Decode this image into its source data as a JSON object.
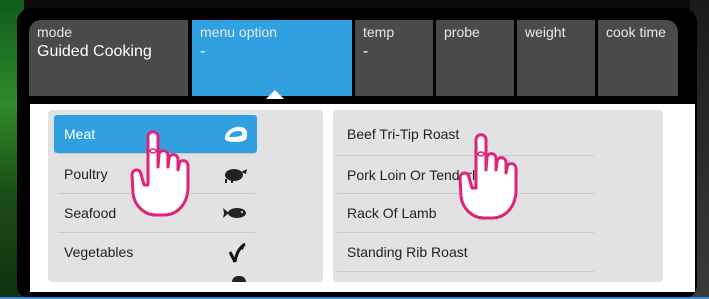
{
  "tabs": [
    {
      "label": "mode",
      "value": "Guided Cooking"
    },
    {
      "label": "menu option",
      "value": "-"
    },
    {
      "label": "temp",
      "value": "-"
    },
    {
      "label": "probe",
      "value": ""
    },
    {
      "label": "weight",
      "value": ""
    },
    {
      "label": "cook time",
      "value": ""
    }
  ],
  "categories": [
    {
      "label": "Meat",
      "icon": "steak-icon",
      "selected": true
    },
    {
      "label": "Poultry",
      "icon": "turkey-icon",
      "selected": false
    },
    {
      "label": "Seafood",
      "icon": "fish-icon",
      "selected": false
    },
    {
      "label": "Vegetables",
      "icon": "sprout-icon",
      "selected": false
    }
  ],
  "recipes": [
    {
      "label": "Beef Tri-Tip Roast"
    },
    {
      "label": "Pork Loin Or Tenderloin"
    },
    {
      "label": "Rack Of Lamb"
    },
    {
      "label": "Standing Rib Roast"
    }
  ],
  "colors": {
    "accent": "#30a0e0",
    "tab_bg": "#4a4a4a",
    "list_bg": "#e2e2e2",
    "hand_outline": "#e0237a"
  }
}
